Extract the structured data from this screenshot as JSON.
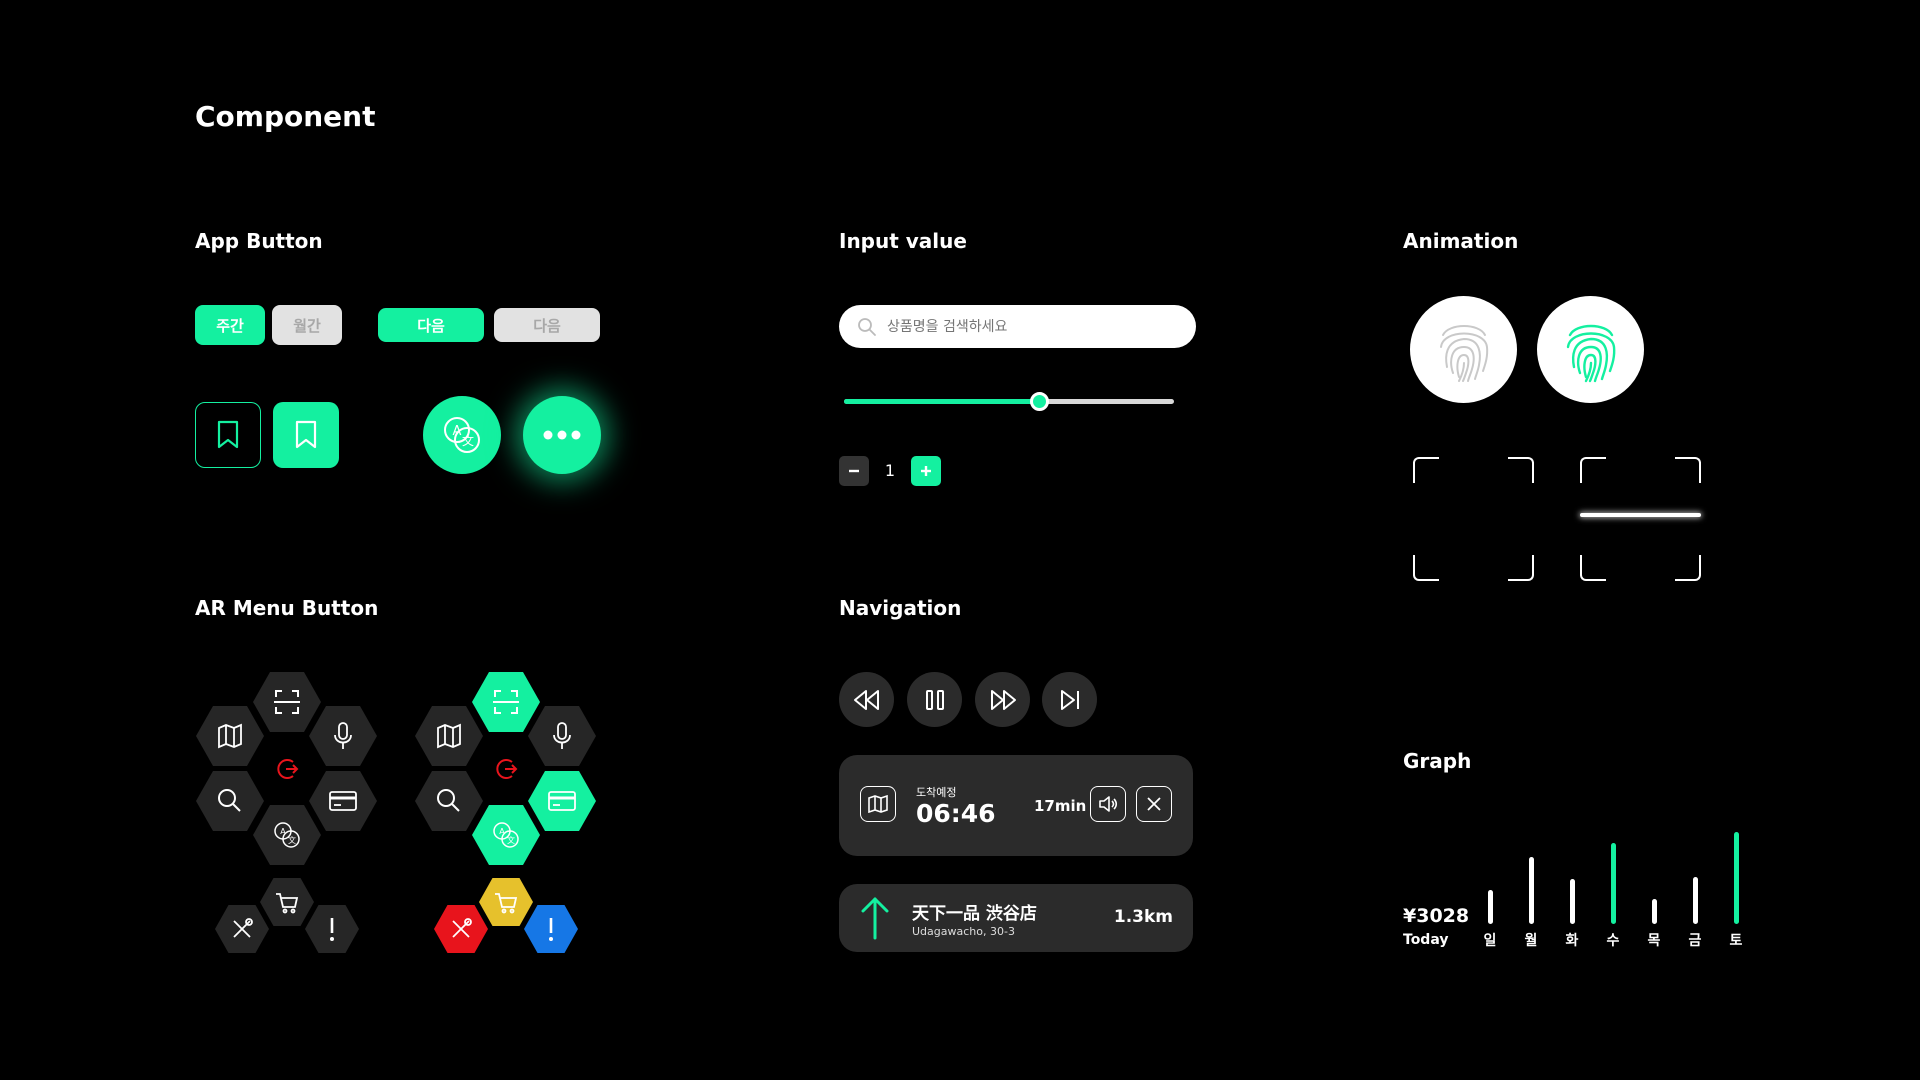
{
  "page_title": "Component",
  "sections": {
    "app_button": "App Button",
    "input_value": "Input value",
    "animation": "Animation",
    "ar_menu_button": "AR Menu Button",
    "navigation": "Navigation",
    "graph": "Graph"
  },
  "app_button": {
    "toggle_weekly": "주간",
    "toggle_monthly": "월간",
    "next_active": "다음",
    "next_disabled": "다음"
  },
  "input": {
    "search_placeholder": "상품명을 검색하세요",
    "slider_value": 0.59,
    "stepper_value": "1"
  },
  "navigation": {
    "arrival_label": "도착예정",
    "arrival_time": "06:46",
    "duration": "17min",
    "destination_name": "天下一品 渋谷店",
    "destination_address": "Udagawacho, 30-3",
    "distance": "1.3km"
  },
  "graph": {
    "total": "¥3028",
    "period": "Today",
    "days": [
      "일",
      "월",
      "화",
      "수",
      "목",
      "금",
      "토"
    ],
    "values": [
      0.37,
      0.73,
      0.49,
      0.88,
      0.27,
      0.51,
      1.0
    ],
    "highlight": [
      false,
      false,
      false,
      true,
      false,
      false,
      true
    ]
  },
  "colors": {
    "accent": "#14f0a0",
    "panel": "#2b2b2b",
    "red": "#e8141c",
    "yellow": "#e6c12c",
    "blue": "#1677e6"
  }
}
